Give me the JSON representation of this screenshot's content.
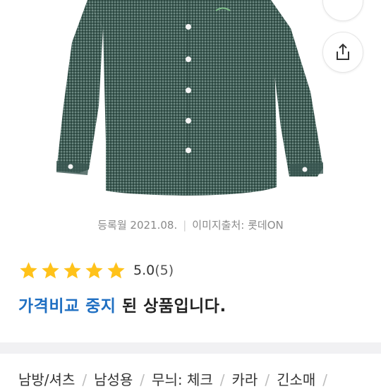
{
  "meta": {
    "registered": "등록월 2021.08.",
    "separator": "|",
    "image_source": "이미지출처: 롯데ON"
  },
  "rating": {
    "stars": 5,
    "score": "5.0",
    "count": "(5)",
    "star_color": "#ffc21a"
  },
  "notice": {
    "highlight": "가격비교 중지",
    "rest": " 된 상품입니다."
  },
  "tags": [
    "남방/셔츠",
    "남성용",
    "무늬: 체크",
    "카라",
    "긴소매"
  ],
  "colors": {
    "accent": "#1f6fc2",
    "shirt": "#4b6a62"
  }
}
